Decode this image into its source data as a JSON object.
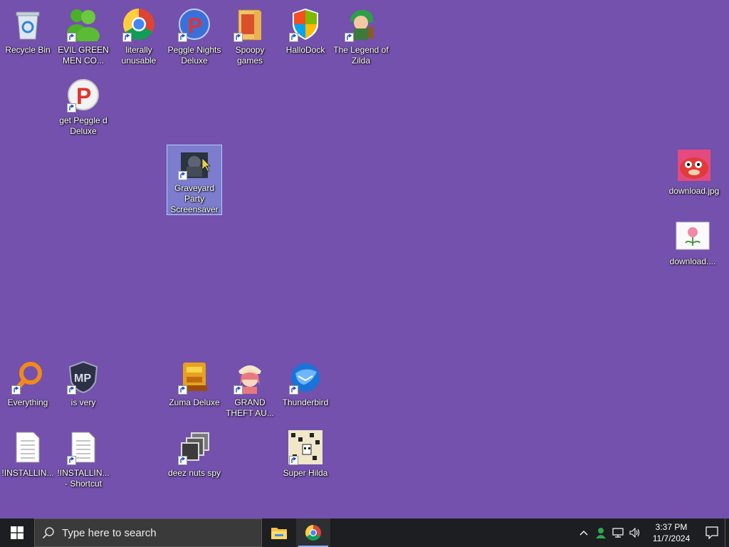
{
  "desktop": {
    "background_color": "#7351ac",
    "icons": [
      {
        "label": "Recycle Bin",
        "icon": "recycle-bin-icon"
      },
      {
        "label": "EVIL GREEN MEN CO...",
        "icon": "green-men-icon"
      },
      {
        "label": "literally unusable",
        "icon": "chrome-icon"
      },
      {
        "label": "Peggle Nights Deluxe",
        "icon": "peggle-nights-icon"
      },
      {
        "label": "Spoopy games",
        "icon": "folder-icon"
      },
      {
        "label": "HalloDock",
        "icon": "windows-shield-icon"
      },
      {
        "label": "The Legend of Zilda",
        "icon": "zilda-icon"
      },
      {
        "label": "get Peggle d Deluxe",
        "icon": "peggle-icon"
      },
      {
        "label": "Graveyard Party Screensaver",
        "icon": "graveyard-icon"
      },
      {
        "label": "download.jpg",
        "icon": "image-icon"
      },
      {
        "label": "download....",
        "icon": "flower-image-icon"
      },
      {
        "label": "Everything",
        "icon": "everything-search-icon"
      },
      {
        "label": "is very",
        "icon": "badge-icon"
      },
      {
        "label": "Zuma Deluxe",
        "icon": "zuma-icon"
      },
      {
        "label": "GRAND THEFT AU...",
        "icon": "anime-girl-icon"
      },
      {
        "label": "Thunderbird",
        "icon": "thunderbird-icon"
      },
      {
        "label": "!INSTALLIN...",
        "icon": "text-file-icon"
      },
      {
        "label": "!INSTALLIN... - Shortcut",
        "icon": "text-file-icon"
      },
      {
        "label": "deez nuts spy",
        "icon": "stacked-windows-icon"
      },
      {
        "label": "Super Hilda",
        "icon": "pixel-art-icon"
      }
    ]
  },
  "taskbar": {
    "search_placeholder": "Type here to search",
    "pinned": [
      "file-explorer-icon",
      "chrome-icon"
    ],
    "tray": [
      "chevron-up-icon",
      "user-icon",
      "network-icon",
      "volume-icon"
    ],
    "clock": {
      "time": "3:37 PM",
      "date": "11/7/2024"
    },
    "notification": "action-center-icon"
  }
}
